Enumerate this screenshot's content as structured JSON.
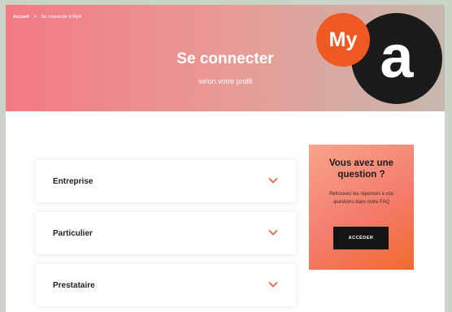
{
  "breadcrumb": {
    "home": "Accueil",
    "separator": ">",
    "current": "Se connecter à MyA"
  },
  "hero": {
    "title": "Se connecter",
    "subtitle": "selon votre profil"
  },
  "logo": {
    "my": "My",
    "a": "a"
  },
  "profiles": [
    {
      "label": "Entreprise"
    },
    {
      "label": "Particulier"
    },
    {
      "label": "Prestataire"
    }
  ],
  "faq": {
    "title_line1": "Vous avez une",
    "title_line2": "question ?",
    "text": "Retrouvez les réponses à vos questions dans notre FAQ",
    "button": "ACCÉDER"
  },
  "icons": {
    "accordion": "chevron-down-icon"
  },
  "colors": {
    "accent": "#ef5a23",
    "logo_dark": "#1b1b1b",
    "hero_gradient_start": "#f27a86",
    "hero_gradient_end": "#c7b8ad"
  }
}
